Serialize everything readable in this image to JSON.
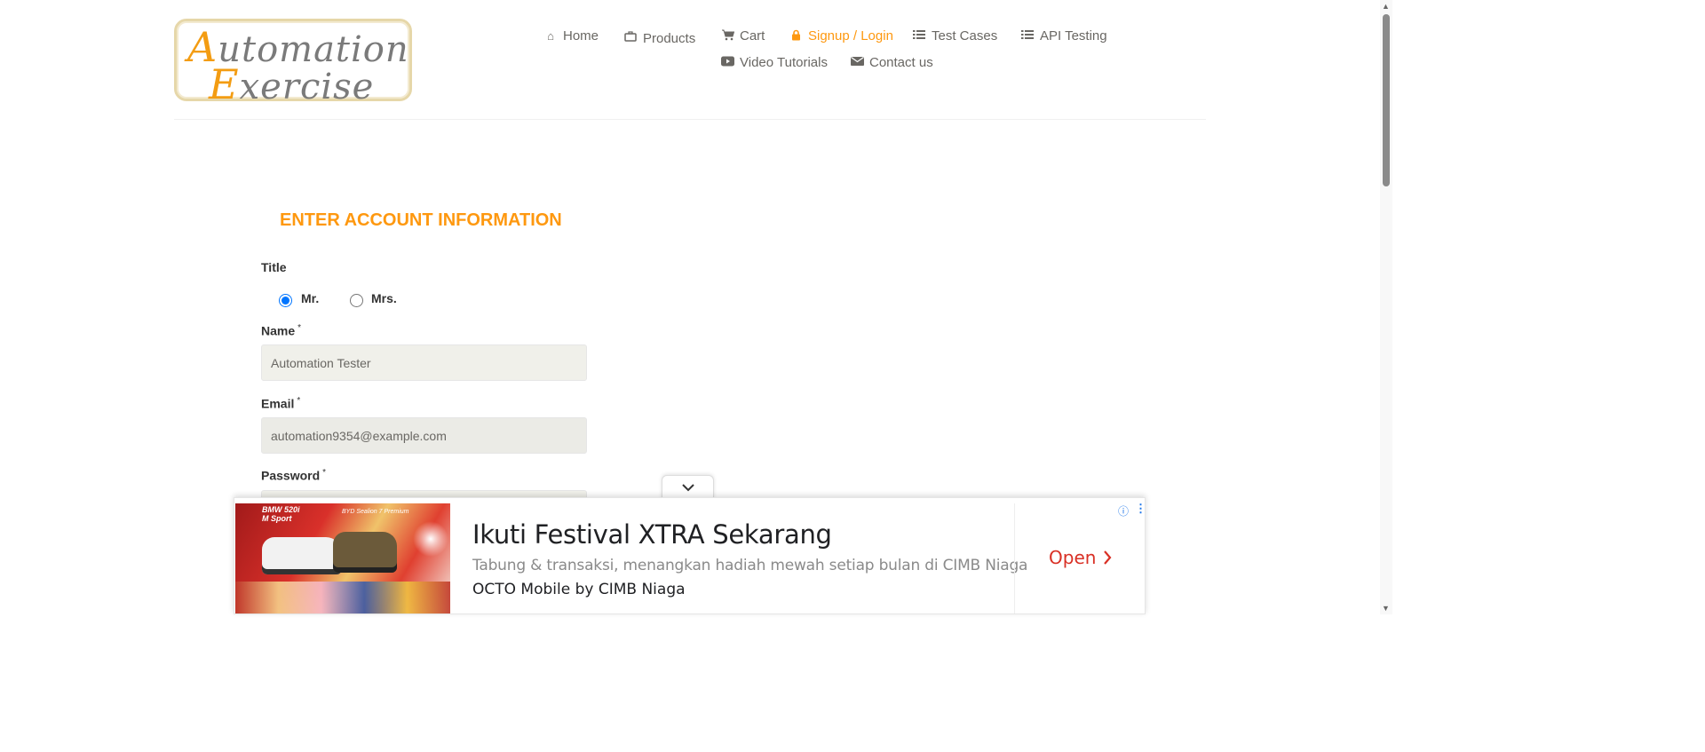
{
  "logo": {
    "line1_cap": "A",
    "line1_rest": "utomation",
    "line2_cap": "E",
    "line2_rest": "xercise"
  },
  "nav": {
    "items": [
      {
        "label": "Home",
        "icon": "home-icon"
      },
      {
        "label": "Products",
        "icon": "briefcase-icon"
      },
      {
        "label": "Cart",
        "icon": "cart-icon"
      },
      {
        "label": "Signup / Login",
        "icon": "lock-icon",
        "active": true
      },
      {
        "label": "Test Cases",
        "icon": "list-icon"
      },
      {
        "label": "API Testing",
        "icon": "list-icon"
      },
      {
        "label": "Video Tutorials",
        "icon": "youtube-play-icon"
      },
      {
        "label": "Contact us",
        "icon": "envelope-icon"
      }
    ]
  },
  "form": {
    "heading": "ENTER ACCOUNT INFORMATION",
    "title_label": "Title",
    "title_options": [
      "Mr.",
      "Mrs."
    ],
    "title_selected": "Mr.",
    "name_label": "Name",
    "name_value": "Automation Tester",
    "email_label": "Email",
    "email_value": "automation9354@example.com",
    "password_label": "Password",
    "required_mark": "*"
  },
  "ad": {
    "image_text_1": "BMW 520i",
    "image_text_2": "M Sport",
    "image_text_3": "BYD Sealion 7 Premium",
    "title": "Ikuti Festival XTRA Sekarang",
    "description": "Tabung & transaksi, menangkan hadiah mewah setiap bulan di CIMB Niaga",
    "advertiser": "OCTO Mobile by CIMB Niaga",
    "cta": "Open",
    "info_icon": "ⓘ",
    "menu_icon": "⋮"
  },
  "colors": {
    "accent": "#fe980f",
    "text": "#696763",
    "field_bg": "#f0f0ea",
    "ad_cta": "#d93025"
  }
}
